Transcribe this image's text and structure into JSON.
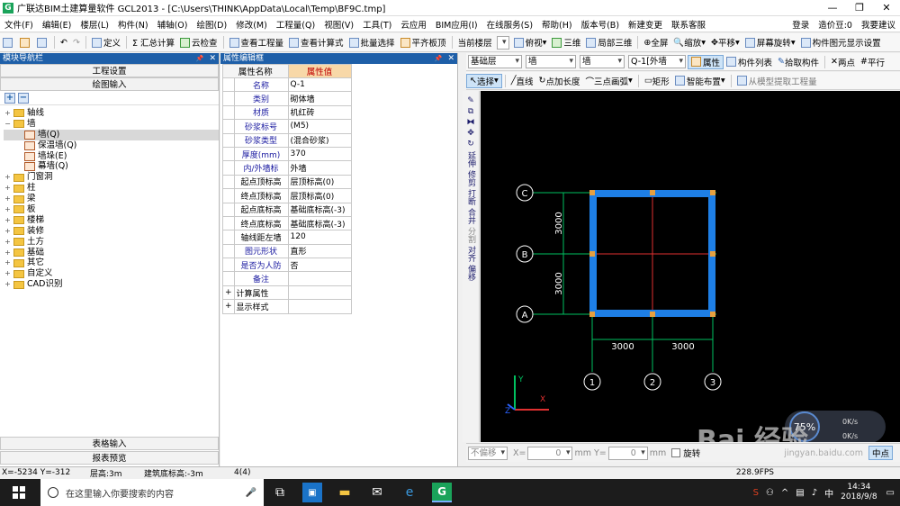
{
  "titlebar": {
    "title": "广联达BIM土建算量软件 GCL2013 - [C:\\Users\\THINK\\AppData\\Local\\Temp\\BF9C.tmp]",
    "logo": "G",
    "minimize": "—",
    "maximize": "❐",
    "close": "✕"
  },
  "menubar": {
    "items": [
      "文件(F)",
      "编辑(E)",
      "楼层(L)",
      "构件(N)",
      "辅轴(O)",
      "绘图(D)",
      "修改(M)",
      "工程量(Q)",
      "视图(V)",
      "工具(T)",
      "云应用",
      "BIM应用(I)",
      "在线服务(S)",
      "帮助(H)",
      "版本号(B)",
      "新建变更",
      "联系客服"
    ],
    "login": "登录",
    "price": "造价豆:0",
    "suggest": "我要建议"
  },
  "toolbar1": {
    "items": [
      "定义",
      "Σ 汇总计算",
      "云检查",
      "查看工程量",
      "查看计算式",
      "批量选择",
      "平齐板顶"
    ]
  },
  "toolbar1r": {
    "items": [
      "当前楼层",
      "俯视",
      "三维",
      "局部三维",
      "全屏",
      "缩放",
      "平移",
      "屏幕旋转",
      "构件图元显示设置"
    ]
  },
  "nav": {
    "header": "模块导航栏",
    "pin": "📌",
    "close": "✕",
    "btn_project": "工程设置",
    "btn_draw": "绘图输入",
    "add": "+",
    "remove": "−",
    "tree": [
      {
        "label": "轴线",
        "level": 0,
        "exp": "+"
      },
      {
        "label": "墙",
        "level": 0,
        "exp": "−"
      },
      {
        "label": "墙(Q)",
        "level": 1,
        "exp": "",
        "selected": true
      },
      {
        "label": "保温墙(Q)",
        "level": 1,
        "exp": ""
      },
      {
        "label": "墙垛(E)",
        "level": 1,
        "exp": ""
      },
      {
        "label": "幕墙(Q)",
        "level": 1,
        "exp": ""
      },
      {
        "label": "门窗洞",
        "level": 0,
        "exp": "+"
      },
      {
        "label": "柱",
        "level": 0,
        "exp": "+"
      },
      {
        "label": "梁",
        "level": 0,
        "exp": "+"
      },
      {
        "label": "板",
        "level": 0,
        "exp": "+"
      },
      {
        "label": "楼梯",
        "level": 0,
        "exp": "+"
      },
      {
        "label": "装修",
        "level": 0,
        "exp": "+"
      },
      {
        "label": "土方",
        "level": 0,
        "exp": "+"
      },
      {
        "label": "基础",
        "level": 0,
        "exp": "+"
      },
      {
        "label": "其它",
        "level": 0,
        "exp": "+"
      },
      {
        "label": "自定义",
        "level": 0,
        "exp": "+"
      },
      {
        "label": "CAD识别",
        "level": 0,
        "exp": "+"
      }
    ],
    "btn_table": "表格输入",
    "btn_report": "报表预览"
  },
  "prop": {
    "header": "属性编辑框",
    "pin": "📌",
    "close": "✕",
    "col_name": "属性名称",
    "col_value": "属性值",
    "rows": [
      {
        "k": "名称",
        "v": "Q-1",
        "black": false
      },
      {
        "k": "类别",
        "v": "砌体墙",
        "black": false
      },
      {
        "k": "材质",
        "v": "机红砖",
        "black": false
      },
      {
        "k": "砂浆标号",
        "v": "(M5)",
        "black": false
      },
      {
        "k": "砂浆类型",
        "v": "(混合砂浆)",
        "black": false
      },
      {
        "k": "厚度(mm)",
        "v": "370",
        "black": false
      },
      {
        "k": "内/外墙标",
        "v": "外墙",
        "black": false
      },
      {
        "k": "起点顶标高",
        "v": "层顶标高(0)",
        "black": true
      },
      {
        "k": "终点顶标高",
        "v": "层顶标高(0)",
        "black": true
      },
      {
        "k": "起点底标高",
        "v": "基础底标高(-3)",
        "black": true
      },
      {
        "k": "终点底标高",
        "v": "基础底标高(-3)",
        "black": true
      },
      {
        "k": "轴线距左墙",
        "v": "120",
        "black": true
      },
      {
        "k": "图元形状",
        "v": "直形",
        "black": false
      },
      {
        "k": "是否为人防",
        "v": "否",
        "black": false
      },
      {
        "k": "备注",
        "v": "",
        "black": false
      },
      {
        "k": "计算属性",
        "v": "",
        "black": true,
        "group": true
      },
      {
        "k": "显示样式",
        "v": "",
        "black": true,
        "group": true
      }
    ]
  },
  "toolbar2": {
    "floor": "基础层",
    "type": "墙",
    "subtype": "墙",
    "comp": "Q-1[外墙",
    "btn_attr": "属性",
    "btn_list": "构件列表",
    "btn_pick": "拾取构件",
    "btn_two": "两点",
    "btn_parallel": "平行"
  },
  "toolbar3": {
    "btn_select": "选择",
    "btn_line": "直线",
    "btn_point": "点加长度",
    "btn_arc": "三点画弧",
    "btn_rect": "矩形",
    "btn_smart": "智能布置",
    "btn_extract": "从模型提取工程量"
  },
  "vbar": {
    "items": [
      "延伸",
      "修剪",
      "打断",
      "合并",
      "分割",
      "对齐",
      "偏移"
    ]
  },
  "canvas": {
    "axis_c": "C",
    "axis_b": "B",
    "axis_a": "A",
    "axis_1": "1",
    "axis_2": "2",
    "axis_3": "3",
    "dim_v1": "3000",
    "dim_v2": "3000",
    "dim_h1": "3000",
    "dim_h2": "3000",
    "ucs_x": "X",
    "ucs_y": "Y",
    "ucs_z": "Z"
  },
  "status1": {
    "nooffset": "不偏移",
    "x_label": "X=",
    "x_val": "0",
    "unit1": "mm",
    "y_label": "Y=",
    "y_val": "0",
    "unit2": "mm",
    "rotate": "旋转",
    "midpoint": "中点"
  },
  "status2": {
    "coords": "X=-5234 Y=-312",
    "floor_h": "层高:3m",
    "bottom": "建筑底标高:-3m",
    "count": "4(4)",
    "fps": "228.9FPS"
  },
  "overlay": {
    "percent": "75%",
    "net1": "0K/s",
    "net2": "0K/s",
    "watermark": "Bai 经验",
    "watermark2": "jingyan.baidu.com"
  },
  "taskbar": {
    "search": "在这里输入你要搜索的内容",
    "ime": "中",
    "time": "14:34",
    "date": "2018/9/8"
  },
  "colors": {
    "navhdr": "#1e5fa8",
    "wall": "#1e7fe6",
    "axis": "#00c060",
    "grid": "#e03030"
  }
}
